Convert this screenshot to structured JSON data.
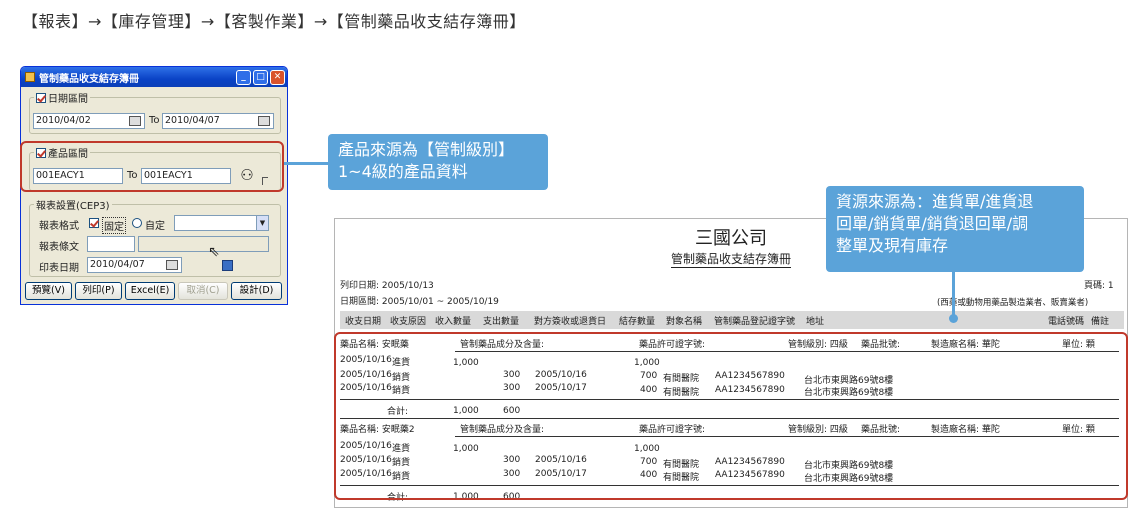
{
  "breadcrumb": "【報表】→【庫存管理】→【客製作業】→【管制藥品收支結存簿冊】",
  "dialog": {
    "title": "管制藥品收支結存簿冊",
    "date_group": {
      "label": "日期區間",
      "from": "2010/04/02",
      "to_label": "To",
      "to": "2010/04/07"
    },
    "product_group": {
      "label": "產品區間",
      "from": "001EACY1",
      "to_label": "To",
      "to": "001EACY1"
    },
    "settings_group": {
      "label": "報表設置(CEP3)",
      "format_label": "報表格式",
      "fixed_label": "固定",
      "custom_label": "自定",
      "text_label": "報表條文",
      "print_date_label": "印表日期",
      "print_date": "2010/04/07"
    },
    "buttons": [
      "預覽(V)",
      "列印(P)",
      "Excel(E)",
      "取消(C)",
      "設計(D)"
    ]
  },
  "callout_left": [
    "產品來源為【管制級別】",
    "1~4級的產品資料"
  ],
  "callout_right": [
    "資源來源為：進貨單/進貨退",
    "回單/銷貨單/銷貨退回單/調",
    "整單及現有庫存"
  ],
  "report": {
    "company": "三國公司",
    "subtitle": "管制藥品收支結存簿冊",
    "print_date": "列印日期: 2005/10/13",
    "page": "頁碼: 1",
    "period": "日期區間: 2005/10/01 ~ 2005/10/19",
    "note": "(西藥或動物用藥品製造業者、販賣業者)",
    "columns": [
      "收支日期",
      "收支原因",
      "收入數量",
      "支出數量",
      "對方簽收或退貨日",
      "結存數量",
      "對象名稱",
      "管制藥品登記證字號",
      "地址"
    ],
    "columns_right": [
      "電話號碼",
      "備註"
    ],
    "sections": [
      {
        "product": "藥品名稱: 安眠藥",
        "ingredient": "管制藥品成分及含量:",
        "license": "藥品許可證字號:",
        "level": "管制級別: 四級",
        "batch": "藥品批號:",
        "maker": "製造廠名稱: 華陀",
        "unit": "單位: 顆",
        "rows": [
          {
            "date": "2005/10/16",
            "reason": "進貨",
            "in": "1,000",
            "out": "",
            "sign": "",
            "bal": "1,000",
            "target": "",
            "reg": "",
            "addr": ""
          },
          {
            "date": "2005/10/16",
            "reason": "銷貨",
            "in": "",
            "out": "300",
            "sign": "2005/10/16",
            "bal": "700",
            "target": "有間醫院",
            "reg": "AA1234567890",
            "addr": "台北市東興路69號8樓"
          },
          {
            "date": "2005/10/16",
            "reason": "銷貨",
            "in": "",
            "out": "300",
            "sign": "2005/10/17",
            "bal": "400",
            "target": "有間醫院",
            "reg": "AA1234567890",
            "addr": "台北市東興路69號8樓"
          }
        ],
        "total_label": "合計:",
        "total_in": "1,000",
        "total_out": "600"
      },
      {
        "product": "藥品名稱: 安眠藥2",
        "ingredient": "管制藥品成分及含量:",
        "license": "藥品許可證字號:",
        "level": "管制級別: 四級",
        "batch": "藥品批號:",
        "maker": "製造廠名稱: 華陀",
        "unit": "單位: 顆",
        "rows": [
          {
            "date": "2005/10/16",
            "reason": "進貨",
            "in": "1,000",
            "out": "",
            "sign": "",
            "bal": "1,000",
            "target": "",
            "reg": "",
            "addr": ""
          },
          {
            "date": "2005/10/16",
            "reason": "銷貨",
            "in": "",
            "out": "300",
            "sign": "2005/10/16",
            "bal": "700",
            "target": "有間醫院",
            "reg": "AA1234567890",
            "addr": "台北市東興路69號8樓"
          },
          {
            "date": "2005/10/16",
            "reason": "銷貨",
            "in": "",
            "out": "300",
            "sign": "2005/10/17",
            "bal": "400",
            "target": "有間醫院",
            "reg": "AA1234567890",
            "addr": "台北市東興路69號8樓"
          }
        ],
        "total_label": "合計:",
        "total_in": "1,000",
        "total_out": "600"
      }
    ]
  },
  "colors": {
    "callout": "#5ba3d9",
    "highlight": "#c0392b",
    "titlebar": "#0a43c6"
  }
}
